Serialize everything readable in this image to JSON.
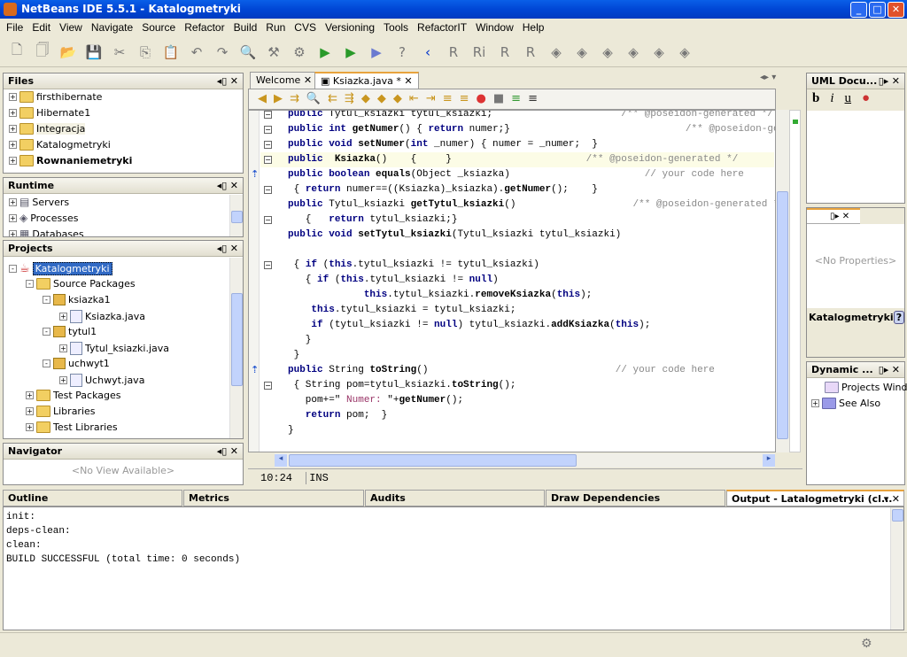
{
  "window": {
    "title": "NetBeans IDE 5.5.1 - Katalogmetryki"
  },
  "menu": [
    "File",
    "Edit",
    "View",
    "Navigate",
    "Source",
    "Refactor",
    "Build",
    "Run",
    "CVS",
    "Versioning",
    "Tools",
    "RefactorIT",
    "Window",
    "Help"
  ],
  "files": {
    "title": "Files",
    "items": [
      "firsthibernate",
      "Hibernate1",
      "Integracja",
      "Katalogmetryki",
      "Rownaniemetryki"
    ]
  },
  "runtime": {
    "title": "Runtime",
    "items": [
      "Servers",
      "Processes",
      "Databases"
    ]
  },
  "projects": {
    "title": "Projects",
    "root": "Katalogmetryki",
    "items": [
      {
        "label": "Source Packages",
        "level": 1,
        "type": "folder",
        "exp": "-"
      },
      {
        "label": "ksiazka1",
        "level": 2,
        "type": "pkg",
        "exp": "-"
      },
      {
        "label": "Ksiazka.java",
        "level": 3,
        "type": "file",
        "exp": "+"
      },
      {
        "label": "tytul1",
        "level": 2,
        "type": "pkg",
        "exp": "-"
      },
      {
        "label": "Tytul_ksiazki.java",
        "level": 3,
        "type": "file",
        "exp": "+"
      },
      {
        "label": "uchwyt1",
        "level": 2,
        "type": "pkg",
        "exp": "-"
      },
      {
        "label": "Uchwyt.java",
        "level": 3,
        "type": "file",
        "exp": "+"
      },
      {
        "label": "Test Packages",
        "level": 1,
        "type": "folder",
        "exp": "+"
      },
      {
        "label": "Libraries",
        "level": 1,
        "type": "folder",
        "exp": "+"
      },
      {
        "label": "Test Libraries",
        "level": 1,
        "type": "folder",
        "exp": "+"
      }
    ]
  },
  "navigator": {
    "title": "Navigator",
    "empty": "<No View Available>"
  },
  "editor": {
    "tabs": [
      "Welcome",
      "Ksiazka.java *"
    ],
    "position": "10:24",
    "mode": "INS",
    "lines": [
      [
        [
          "public ",
          "kw"
        ],
        [
          "Tytul_ksiazki tytul_ksiazki;                      ",
          ""
        ],
        [
          "/** @poseidon-generated */",
          "c"
        ]
      ],
      [
        [
          "public int ",
          "kw"
        ],
        [
          "getNumer",
          "b"
        ],
        [
          "() { ",
          ""
        ],
        [
          "return ",
          "kw"
        ],
        [
          "numer;}                              ",
          ""
        ],
        [
          "/** @poseidon-generated */",
          "c"
        ]
      ],
      [
        [
          "public void ",
          "kw"
        ],
        [
          "setNumer",
          "b"
        ],
        [
          "(",
          ""
        ],
        [
          "int ",
          "kw"
        ],
        [
          "_numer) { numer = _numer;  }",
          ""
        ]
      ],
      [
        [
          "public  ",
          "kw"
        ],
        [
          "Ksiazka",
          "b"
        ],
        [
          "()    {     }                       ",
          ""
        ],
        [
          "/** @poseidon-generated */",
          "c"
        ]
      ],
      [
        [
          "public boolean ",
          "kw"
        ],
        [
          "equals",
          "b"
        ],
        [
          "(Object _ksiazka)                       ",
          ""
        ],
        [
          "// your code here",
          "c"
        ]
      ],
      [
        [
          " { ",
          ""
        ],
        [
          "return ",
          "kw"
        ],
        [
          "numer==((Ksiazka)_ksiazka).",
          ""
        ],
        [
          "getNumer",
          "b"
        ],
        [
          "();    }",
          ""
        ]
      ],
      [
        [
          "public ",
          "kw"
        ],
        [
          "Tytul_ksiazki ",
          ""
        ],
        [
          "getTytul_ksiazki",
          "b"
        ],
        [
          "()                    ",
          ""
        ],
        [
          "/** @poseidon-generated */",
          "c"
        ]
      ],
      [
        [
          "   {   ",
          ""
        ],
        [
          "return ",
          "kw"
        ],
        [
          "tytul_ksiazki;}",
          ""
        ]
      ],
      [
        [
          "public void ",
          "kw"
        ],
        [
          "setTytul_ksiazki",
          "b"
        ],
        [
          "(Tytul_ksiazki tytul_ksiazki)",
          ""
        ]
      ],
      [],
      [
        [
          " { ",
          ""
        ],
        [
          "if ",
          "kw"
        ],
        [
          "(",
          ""
        ],
        [
          "this",
          "kw"
        ],
        [
          ".tytul_ksiazki != tytul_ksiazki)",
          ""
        ]
      ],
      [
        [
          "   { ",
          ""
        ],
        [
          "if ",
          "kw"
        ],
        [
          "(",
          ""
        ],
        [
          "this",
          "kw"
        ],
        [
          ".tytul_ksiazki != ",
          ""
        ],
        [
          "null",
          "kw"
        ],
        [
          ")",
          ""
        ]
      ],
      [
        [
          "             ",
          ""
        ],
        [
          "this",
          "kw"
        ],
        [
          ".tytul_ksiazki.",
          ""
        ],
        [
          "removeKsiazka",
          "b"
        ],
        [
          "(",
          ""
        ],
        [
          "this",
          "kw"
        ],
        [
          ");",
          ""
        ]
      ],
      [
        [
          "    ",
          ""
        ],
        [
          "this",
          "kw"
        ],
        [
          ".tytul_ksiazki = tytul_ksiazki;",
          ""
        ]
      ],
      [
        [
          "    ",
          ""
        ],
        [
          "if ",
          "kw"
        ],
        [
          "(tytul_ksiazki != ",
          ""
        ],
        [
          "null",
          "kw"
        ],
        [
          ") tytul_ksiazki.",
          ""
        ],
        [
          "addKsiazka",
          "b"
        ],
        [
          "(",
          ""
        ],
        [
          "this",
          "kw"
        ],
        [
          ");",
          ""
        ]
      ],
      [
        [
          "   }",
          ""
        ]
      ],
      [
        [
          " }",
          ""
        ]
      ],
      [
        [
          "public ",
          "kw"
        ],
        [
          "String ",
          ""
        ],
        [
          "toString",
          "b"
        ],
        [
          "()                                ",
          ""
        ],
        [
          "// your code here",
          "c"
        ]
      ],
      [
        [
          " { String pom=tytul_ksiazki.",
          ""
        ],
        [
          "toString",
          "b"
        ],
        [
          "();",
          ""
        ]
      ],
      [
        [
          "   pom+=\"",
          ""
        ],
        [
          " Numer: ",
          "s"
        ],
        [
          "\"+",
          ""
        ],
        [
          "getNumer",
          "b"
        ],
        [
          "();",
          ""
        ]
      ],
      [
        [
          "   ",
          ""
        ],
        [
          "return ",
          "kw"
        ],
        [
          "pom;  }",
          ""
        ]
      ],
      [
        [
          "}",
          ""
        ]
      ]
    ]
  },
  "uml": {
    "title": "UML Docu...",
    "buttons": [
      "b",
      "i",
      "u"
    ]
  },
  "properties": {
    "empty": "<No Properties>",
    "node": "Katalogmetryki"
  },
  "dynamic": {
    "title": "Dynamic ...",
    "items": [
      "Projects Window",
      "See Also"
    ]
  },
  "bottom_tabs": [
    "Outline",
    "Metrics",
    "Audits",
    "Draw Dependencies",
    "Output - Latalogmetryki (cl..."
  ],
  "output": [
    "init:",
    "deps-clean:",
    "clean:",
    "BUILD SUCCESSFUL (total time: 0 seconds)"
  ]
}
